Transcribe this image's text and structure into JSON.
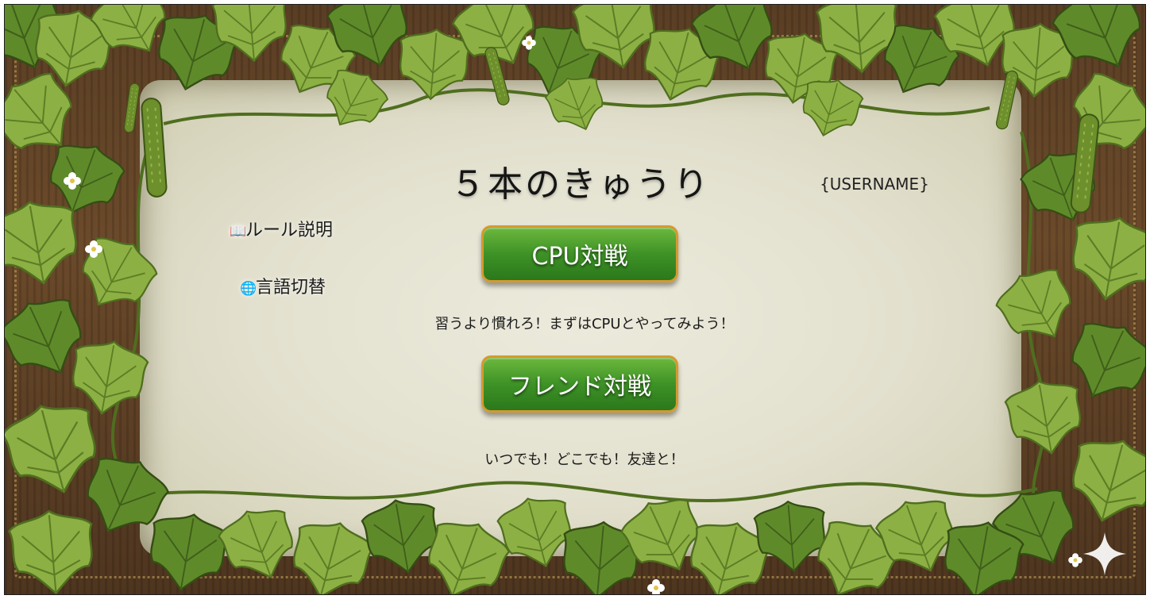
{
  "title": "５本のきゅうり",
  "username": "{USERNAME}",
  "menu": {
    "rules_icon": "📖",
    "rules_label": "ルール説明",
    "language_icon": "🌐",
    "language_label": "言語切替"
  },
  "buttons": {
    "cpu_label": "CPU対戦",
    "cpu_caption": "習うより慣れろ！まずはCPUとやってみよう！",
    "friend_label": "フレンド対戦",
    "friend_caption": "いつでも！どこでも！友達と！"
  },
  "icons": {
    "sparkle": "sparkle-icon",
    "rules": "book-icon",
    "language": "globe-icon"
  },
  "colors": {
    "button_green": "#3e9226",
    "button_border": "#d49a2e",
    "leaf_green": "#8cb043",
    "parchment": "#e4e2d0"
  }
}
